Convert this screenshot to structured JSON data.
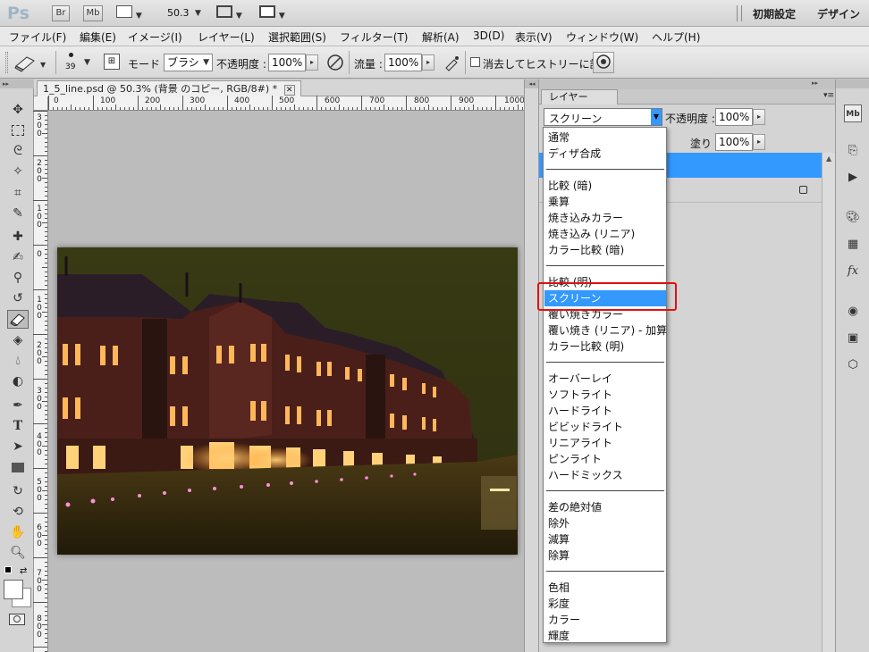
{
  "appbar": {
    "logo": "Ps",
    "bridge": "Br",
    "minibridge": "Mb",
    "zoom": "50.3",
    "workspace_default": "初期設定",
    "workspace_design": "デザイン"
  },
  "menu": [
    "ファイル(F)",
    "編集(E)",
    "イメージ(I)",
    "レイヤー(L)",
    "選択範囲(S)",
    "フィルター(T)",
    "解析(A)",
    "3D(D)",
    "表示(V)",
    "ウィンドウ(W)",
    "ヘルプ(H)"
  ],
  "options": {
    "brush_size": "39",
    "mode_label": "モード :",
    "mode_value": "ブラシ",
    "opacity_label": "不透明度 :",
    "opacity_value": "100%",
    "flow_label": "流量 :",
    "flow_value": "100%",
    "history_label": "消去してヒストリーに記録"
  },
  "document": {
    "tab_title": "1_5_line.psd @ 50.3% (背景 のコピー, RGB/8#) *",
    "close": "✕",
    "ruler_top": [
      "0",
      "100",
      "200",
      "300",
      "400",
      "500",
      "600",
      "700",
      "800",
      "900",
      "1000"
    ],
    "ruler_left": [
      "300",
      "200",
      "100",
      "0",
      "100",
      "200",
      "300",
      "400",
      "500",
      "600",
      "700",
      "800"
    ]
  },
  "layers_panel": {
    "tab": "レイヤー",
    "blend_mode": "スクリーン",
    "opacity_label": "不透明度 :",
    "opacity_value": "100%",
    "fill_label": "塗り :",
    "fill_value": "100%"
  },
  "blend_modes": [
    [
      "通常",
      "ディザ合成"
    ],
    [
      "比較 (暗)",
      "乗算",
      "焼き込みカラー",
      "焼き込み (リニア)",
      "カラー比較 (暗)"
    ],
    [
      "比較 (明)",
      "スクリーン",
      "覆い焼きカラー",
      "覆い焼き (リニア) - 加算",
      "カラー比較 (明)"
    ],
    [
      "オーバーレイ",
      "ソフトライト",
      "ハードライト",
      "ビビッドライト",
      "リニアライト",
      "ピンライト",
      "ハードミックス"
    ],
    [
      "差の絶対値",
      "除外",
      "減算",
      "除算"
    ],
    [
      "色相",
      "彩度",
      "カラー",
      "輝度"
    ]
  ],
  "selected_blend_mode": "スクリーン",
  "colors": {
    "selection": "#3399ff",
    "highlight_box": "#e21010",
    "sky": "#3a3c16",
    "brick": "#4a1f1a"
  }
}
